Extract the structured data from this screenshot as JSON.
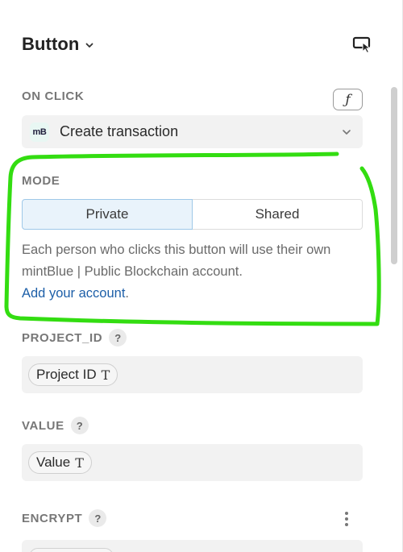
{
  "header": {
    "title": "Button",
    "chevron_icon": "chevron-down-icon",
    "select_icon": "element-select-icon"
  },
  "on_click": {
    "label": "ON CLICK",
    "function_toggle": "ƒ",
    "action_logo": "mB",
    "action_value": "Create transaction"
  },
  "mode": {
    "label": "MODE",
    "options": [
      "Private",
      "Shared"
    ],
    "selected": "Private",
    "description": "Each person who clicks this button will use their own mintBlue | Public Blockchain account.",
    "link_text": "Add your account",
    "link_suffix": "."
  },
  "project_id": {
    "label": "PROJECT_ID",
    "help": "?",
    "token_label": "Project ID",
    "token_type": "T"
  },
  "value": {
    "label": "VALUE",
    "help": "?",
    "token_label": "Value",
    "token_type": "T"
  },
  "encrypt": {
    "label": "ENCRYPT",
    "help": "?",
    "menu_icon": "kebab-menu-icon"
  },
  "colors": {
    "annotation": "#33dd11",
    "link": "#1d5fa8",
    "selected_bg": "#e9f3fb",
    "selected_border": "#9ec8e8"
  }
}
